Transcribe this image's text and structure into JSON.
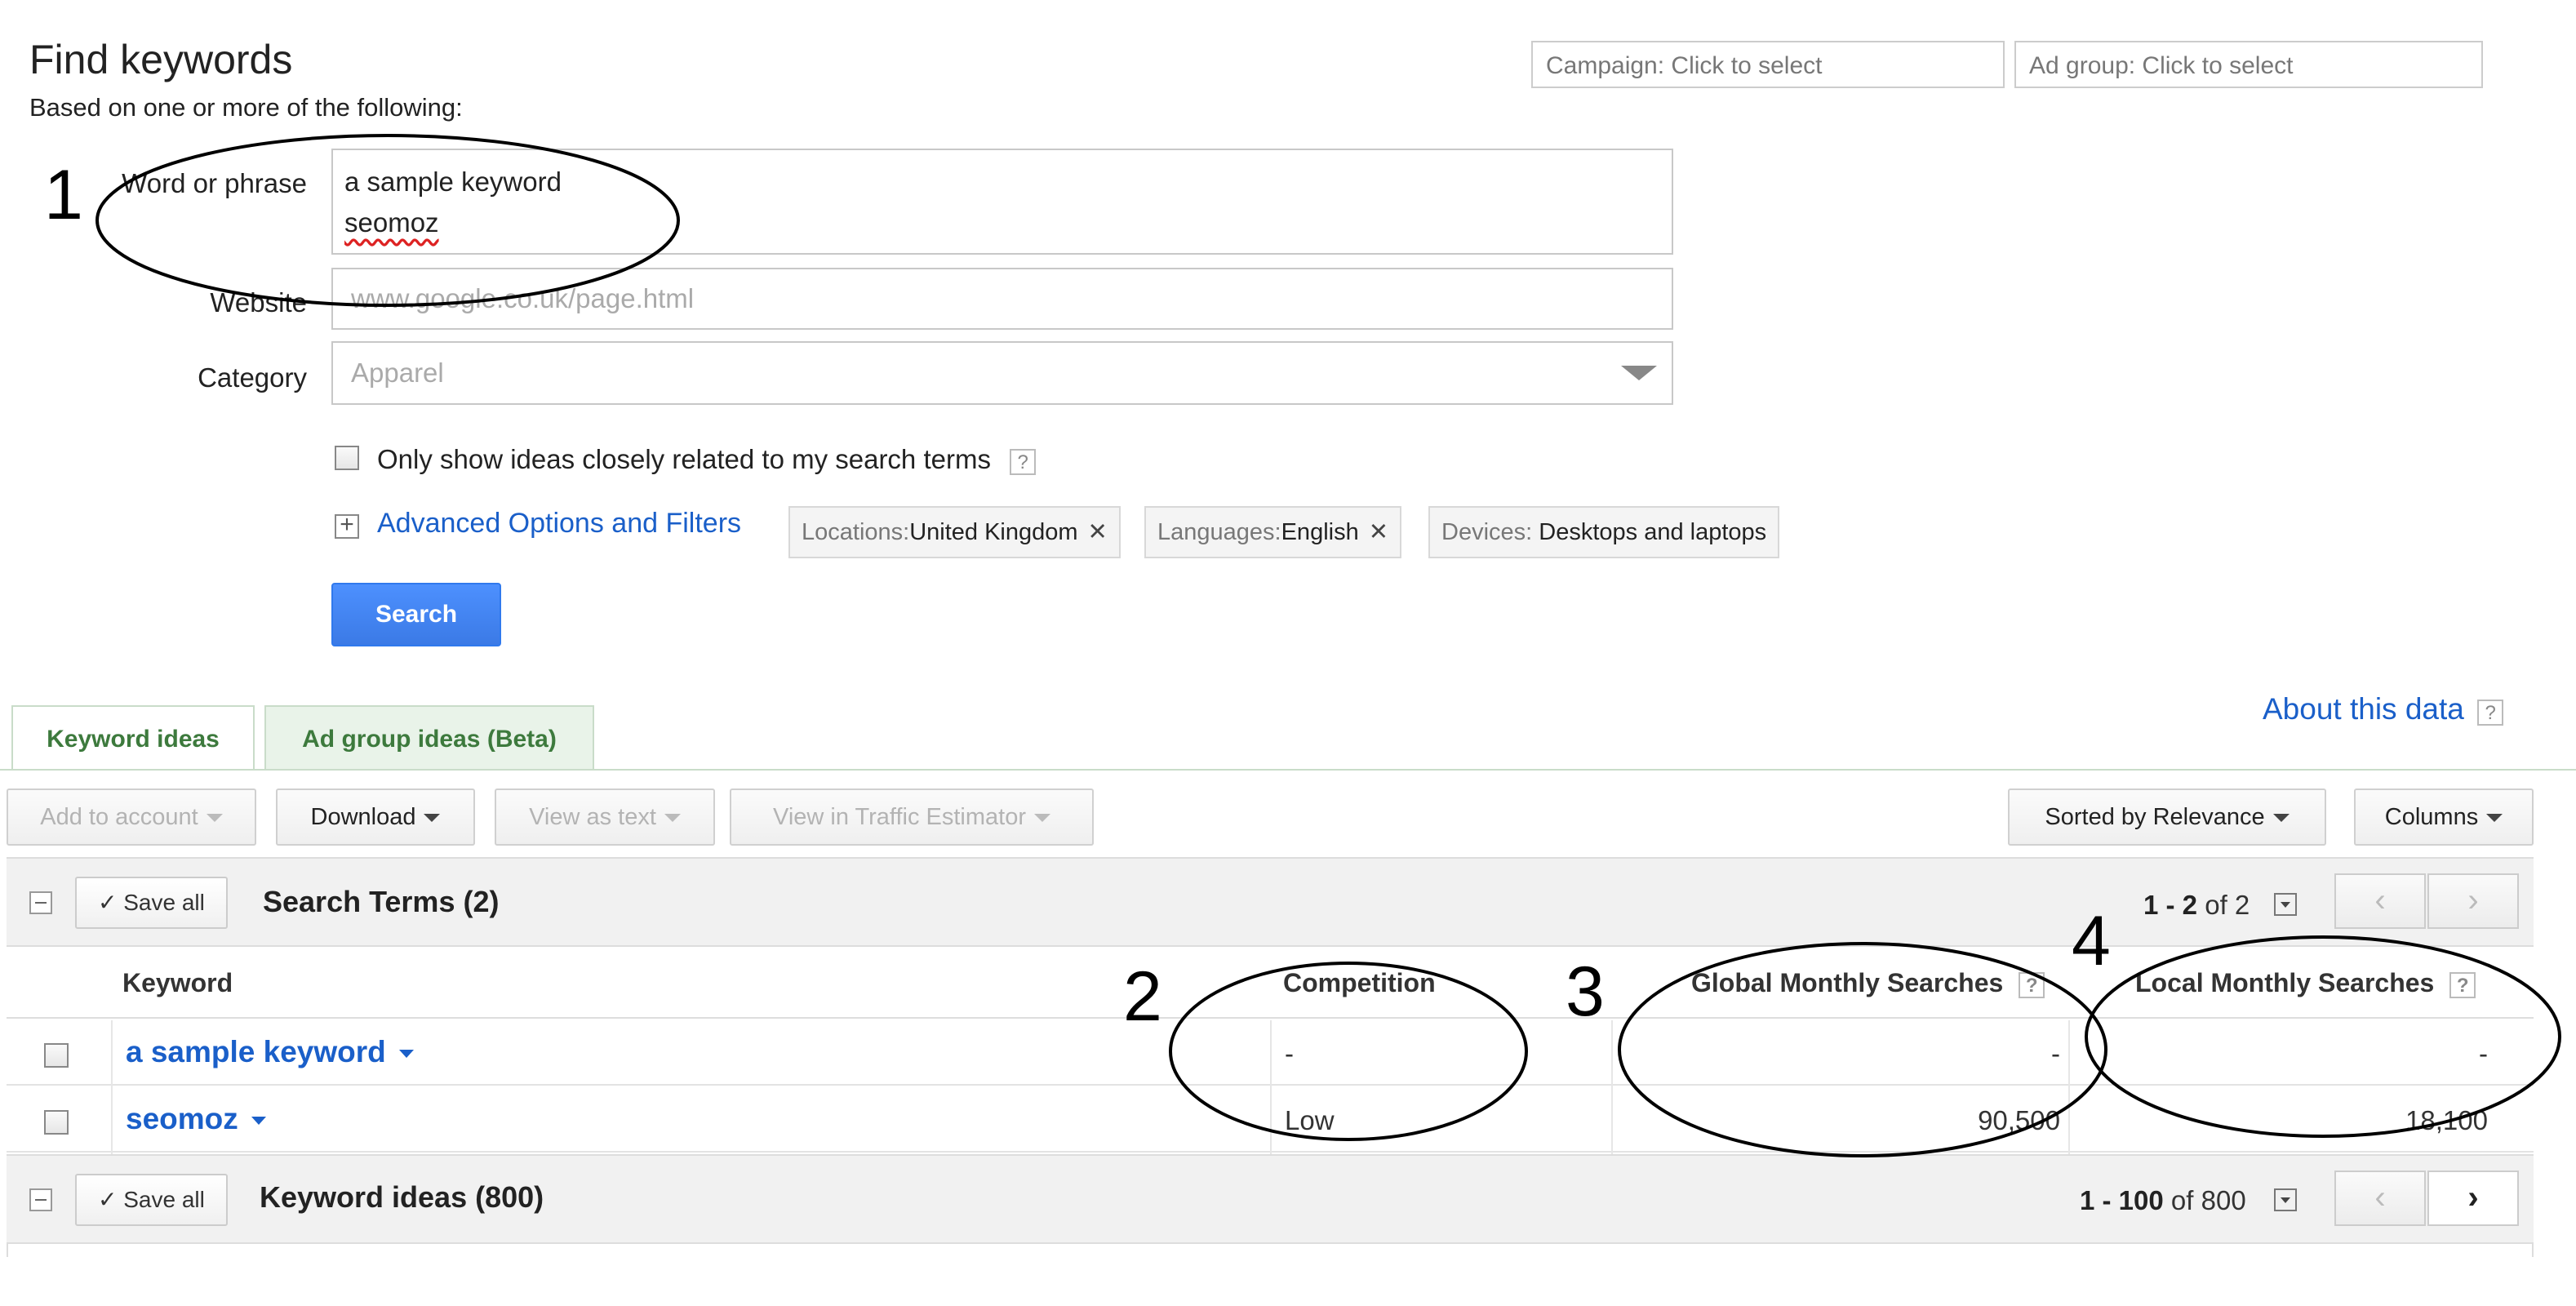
{
  "header": {
    "title": "Find keywords",
    "subtitle": "Based on one or more of the following:",
    "campaign_selector": "Campaign: Click to select",
    "adgroup_selector": "Ad group: Click to select"
  },
  "form": {
    "word_label": "Word or phrase",
    "word_lines": [
      "a sample keyword",
      "seomoz"
    ],
    "website_label": "Website",
    "website_placeholder": "www.google.co.uk/page.html",
    "category_label": "Category",
    "category_placeholder": "Apparel",
    "only_related_label": "Only show ideas closely related to my search terms",
    "help_glyph": "?",
    "advanced_label": "Advanced Options and Filters",
    "advanced_glyph": "+",
    "filters": [
      {
        "key": "Locations:",
        "value": "United Kingdom",
        "remove": "✕"
      },
      {
        "key": "Languages:",
        "value": "English",
        "remove": "✕"
      },
      {
        "key": "Devices:",
        "value": "Desktops and laptops"
      }
    ],
    "search_label": "Search"
  },
  "tabs": {
    "keyword_ideas": "Keyword ideas",
    "ad_group_ideas": "Ad group ideas (Beta)",
    "about": "About this data"
  },
  "toolbar": {
    "add_to_account": "Add to account",
    "download": "Download",
    "view_as_text": "View as text",
    "view_in_estimator": "View in Traffic Estimator",
    "sorted": "Sorted by Relevance",
    "columns": "Columns"
  },
  "search_terms": {
    "save_all": "Save all",
    "save_check": "✓",
    "title": "Search Terms (2)",
    "pager_range": "1 - 2",
    "pager_of": "of 2",
    "prev": "‹",
    "next": "›"
  },
  "table": {
    "headers": {
      "keyword": "Keyword",
      "competition": "Competition",
      "global": "Global Monthly Searches",
      "local": "Local Monthly Searches"
    },
    "rows": [
      {
        "keyword": "a sample keyword",
        "competition": "-",
        "global": "-",
        "local": "-"
      },
      {
        "keyword": "seomoz",
        "competition": "Low",
        "global": "90,500",
        "local": "18,100"
      }
    ]
  },
  "keyword_ideas": {
    "save_all": "Save all",
    "save_check": "✓",
    "title": "Keyword ideas (800)",
    "pager_range": "1 - 100",
    "pager_of": "of 800",
    "prev": "‹",
    "next": "›"
  },
  "annotations": {
    "n1": "1",
    "n2": "2",
    "n3": "3",
    "n4": "4"
  }
}
